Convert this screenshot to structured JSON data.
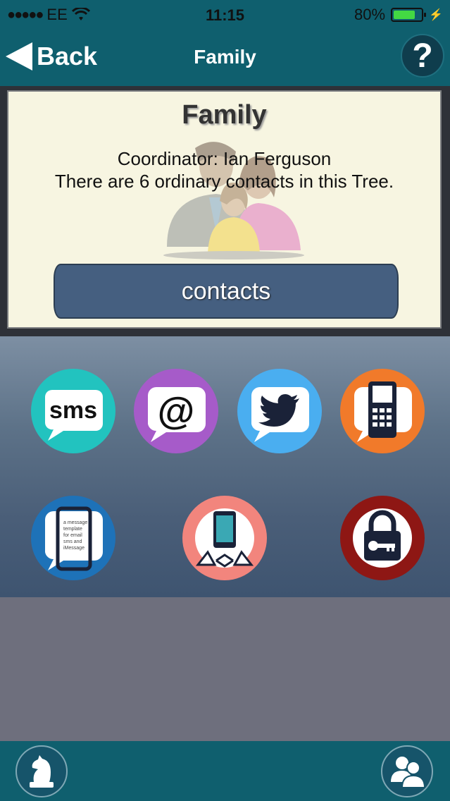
{
  "status_bar": {
    "signal_dots": "●●●●●",
    "carrier": "EE",
    "time": "11:15",
    "battery_percent_text": "80%",
    "battery_level": 0.8
  },
  "nav": {
    "back_label": "Back",
    "title": "Family",
    "help_label": "?"
  },
  "card": {
    "title": "Family",
    "coordinator_text": "Coordinator: Ian Ferguson",
    "count_text": "There are 6 ordinary contacts in this Tree.",
    "contacts_button_label": "contacts"
  },
  "actions": {
    "sms": {
      "icon": "sms-bubble-icon",
      "label": "sms",
      "color": "#22c3bf"
    },
    "email": {
      "icon": "at-sign-icon",
      "label": "@",
      "color": "#a65bc9"
    },
    "twitter": {
      "icon": "twitter-bird-icon",
      "color": "#4aaef0"
    },
    "phone": {
      "icon": "mobile-phone-icon",
      "color": "#f17a2a"
    },
    "template": {
      "icon": "message-template-icon",
      "text_lines": [
        "a message",
        "template",
        "for email",
        "sms and",
        "iMessage"
      ],
      "color": "#1e72b8"
    },
    "share": {
      "icon": "phone-share-icon",
      "color": "#f2857d"
    },
    "lock": {
      "icon": "padlock-key-icon",
      "color": "#8e1714"
    }
  },
  "bottom_bar": {
    "left_icon": "chess-knight-icon",
    "right_icon": "family-group-icon"
  },
  "colors": {
    "teal": "#0f5f6e",
    "card_bg": "#f7f5e1",
    "contacts_btn": "#455f80"
  }
}
